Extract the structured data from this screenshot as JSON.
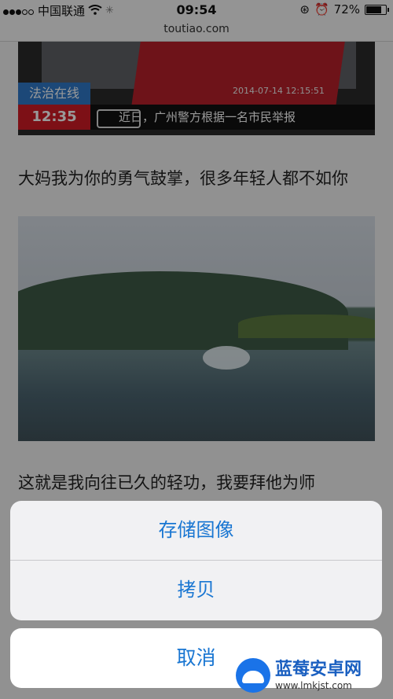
{
  "status_bar": {
    "carrier": "中国联通",
    "time": "09:54",
    "battery": "72%"
  },
  "browser": {
    "url": "toutiao.com"
  },
  "article": {
    "news_image": {
      "tag": "法治在线",
      "time": "12:35",
      "date": "2014-07-14 12:15:51",
      "ticker": "近日，广州警方根据一名市民举报"
    },
    "caption_1": "大妈我为你的勇气鼓掌，很多年轻人都不如你",
    "caption_2": "这就是我向往已久的轻功，我要拜他为师"
  },
  "action_sheet": {
    "save_image": "存储图像",
    "copy": "拷贝",
    "cancel": "取消"
  },
  "watermark": {
    "title": "蓝莓安卓网",
    "url": "www.lmkjst.com"
  },
  "colors": {
    "accent": "#1976d2",
    "news_red": "#d01c25",
    "news_blue": "#2f79c9"
  }
}
